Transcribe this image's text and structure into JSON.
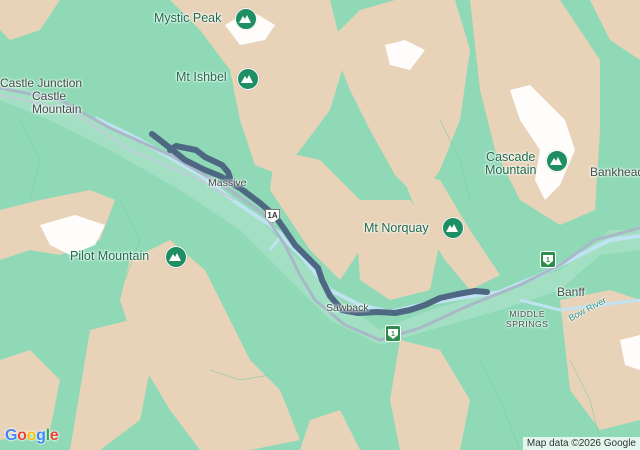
{
  "map": {
    "places": {
      "castle_junction": "Castle Junction",
      "castle_mountain": "Castle\nMountain",
      "massive": "Massive",
      "sawback": "Sawback",
      "banff": "Banff",
      "middle_springs": "MIDDLE\nSPRINGS",
      "bankhead": "Bankhead"
    },
    "peaks": {
      "mystic_peak": "Mystic Peak",
      "mt_ishbel": "Mt Ishbel",
      "cascade_mountain": "Cascade\nMountain",
      "mt_norquay": "Mt Norquay",
      "pilot_mountain": "Pilot Mountain"
    },
    "river": "Bow River",
    "highway_1a": "1A",
    "highway_1": "1",
    "route_color": "#4e6884",
    "forest_color": "#8fd9b6",
    "terrain_color": "#e6d2b8",
    "snow_color": "#ffffff"
  },
  "footer": {
    "logo": "Google",
    "attribution": "Map data ©2026 Google"
  }
}
